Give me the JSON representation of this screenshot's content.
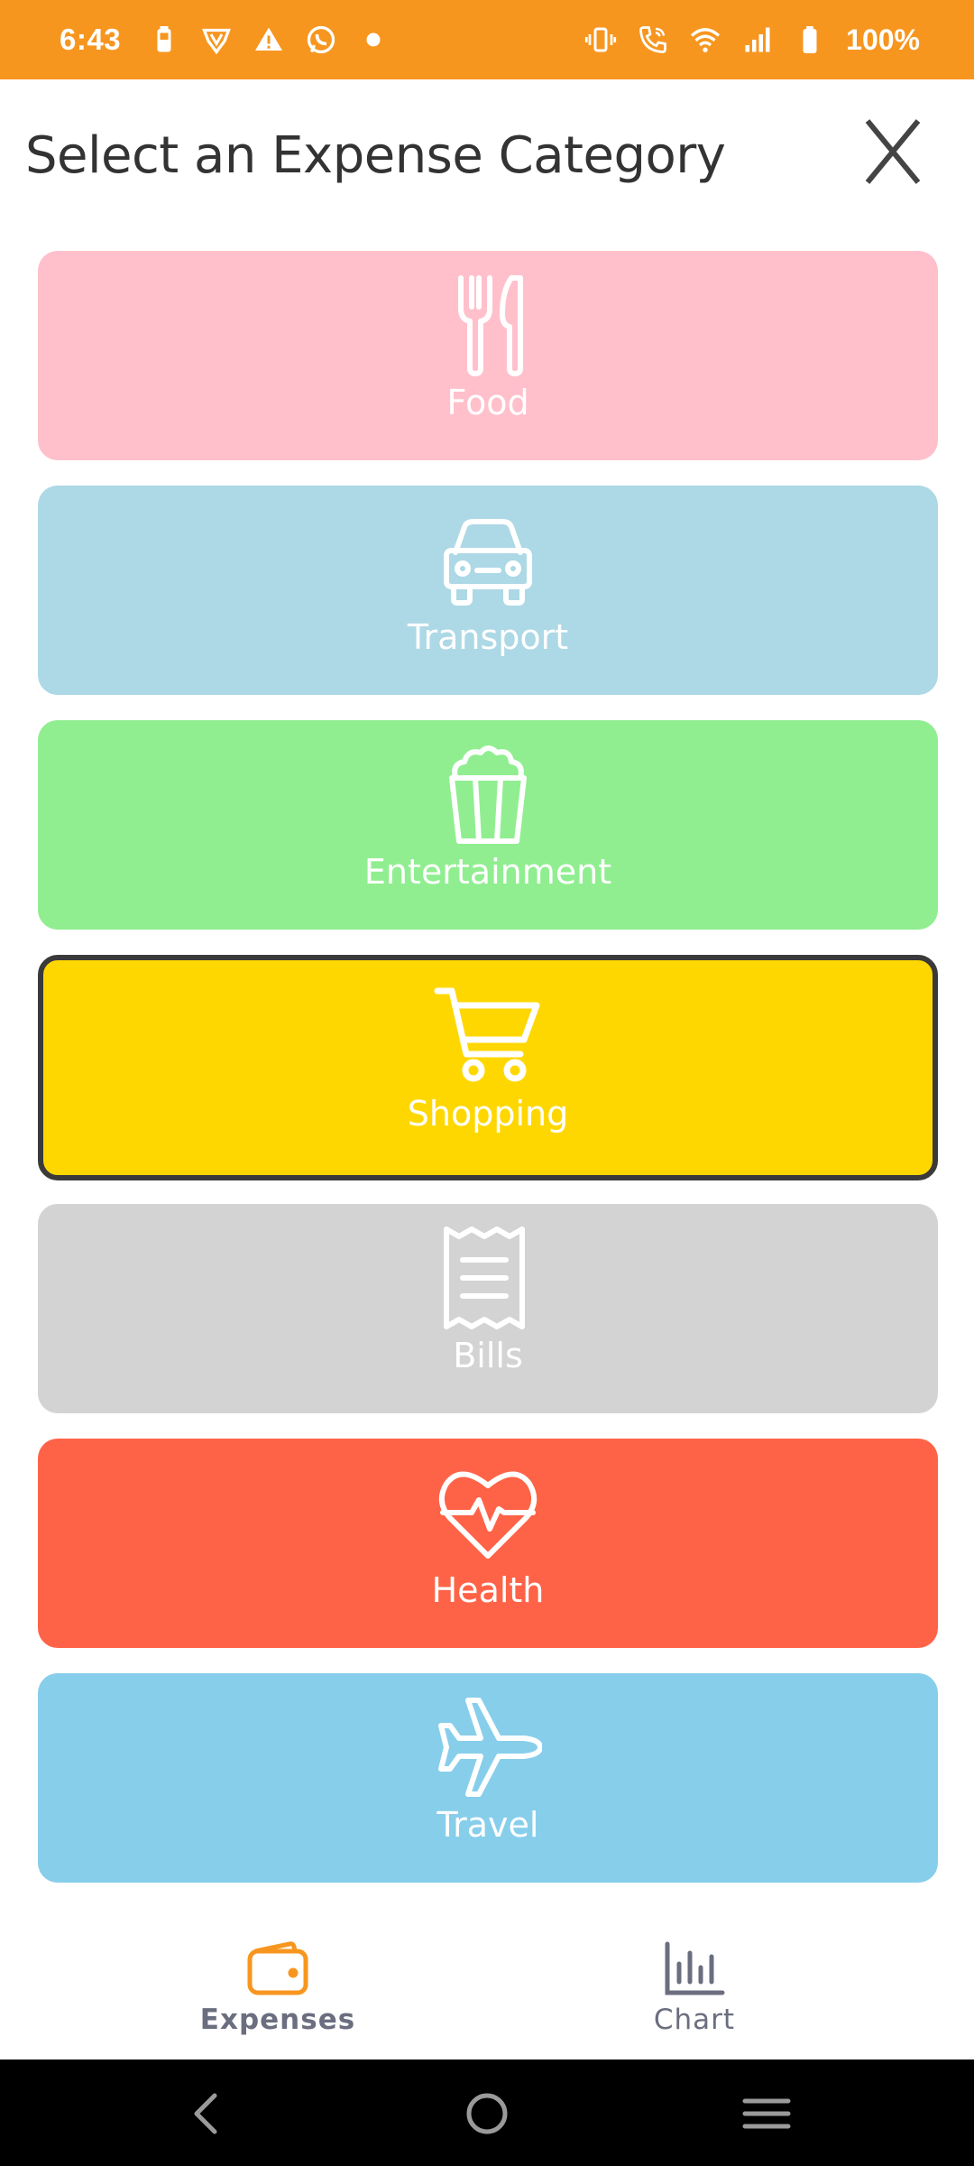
{
  "status_bar": {
    "time": "6:43",
    "battery": "100%",
    "left_icons": [
      "battery-saver-icon",
      "vpn-shield-icon",
      "warning-icon",
      "whatsapp-icon",
      "dot-icon"
    ],
    "right_icons": [
      "vibrate-icon",
      "wifi-calling-icon",
      "wifi-icon",
      "signal-icon",
      "battery-icon"
    ],
    "background_color": "#f7961f"
  },
  "header": {
    "title": "Select an Expense Category",
    "close_label": "X"
  },
  "categories": [
    {
      "label": "Food",
      "icon": "fork-knife-icon",
      "color": "#ffc0cb",
      "selected": false
    },
    {
      "label": "Transport",
      "icon": "car-icon",
      "color": "#add8e6",
      "selected": false
    },
    {
      "label": "Entertainment",
      "icon": "popcorn-icon",
      "color": "#90ee90",
      "selected": false
    },
    {
      "label": "Shopping",
      "icon": "shopping-cart-icon",
      "color": "#ffd700",
      "selected": true
    },
    {
      "label": "Bills",
      "icon": "receipt-icon",
      "color": "#d3d3d3",
      "selected": false
    },
    {
      "label": "Health",
      "icon": "heart-pulse-icon",
      "color": "#ff6347",
      "selected": false
    },
    {
      "label": "Travel",
      "icon": "airplane-icon",
      "color": "#87ceeb",
      "selected": false
    }
  ],
  "tabs": [
    {
      "label": "Expenses",
      "icon": "wallet-icon",
      "active": true,
      "color": "#f7961f"
    },
    {
      "label": "Chart",
      "icon": "bar-chart-icon",
      "active": false,
      "color": "#6b6e7f"
    }
  ],
  "nav_bar": {
    "buttons": [
      "back-icon",
      "home-icon",
      "recents-icon"
    ]
  }
}
